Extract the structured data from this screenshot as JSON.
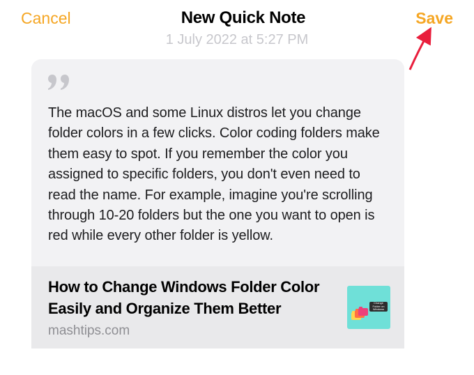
{
  "header": {
    "cancel_label": "Cancel",
    "title": "New Quick Note",
    "save_label": "Save"
  },
  "timestamp": "1 July 2022 at 5:27 PM",
  "note": {
    "text": "The macOS and some Linux distros let you change folder colors in a few clicks. Color coding folders make them easy to spot. If you remember the color you assigned to specific folders, you don't even need to read the name. For example, imagine you're scrolling through 10-20 folders but the one you want to open is red while every other folder is yellow."
  },
  "link_preview": {
    "title": "How to Change Windows Folder Color Easily and Organize Them Better",
    "domain": "mashtips.com",
    "thumb_caption": "Change Folder on Windows"
  }
}
